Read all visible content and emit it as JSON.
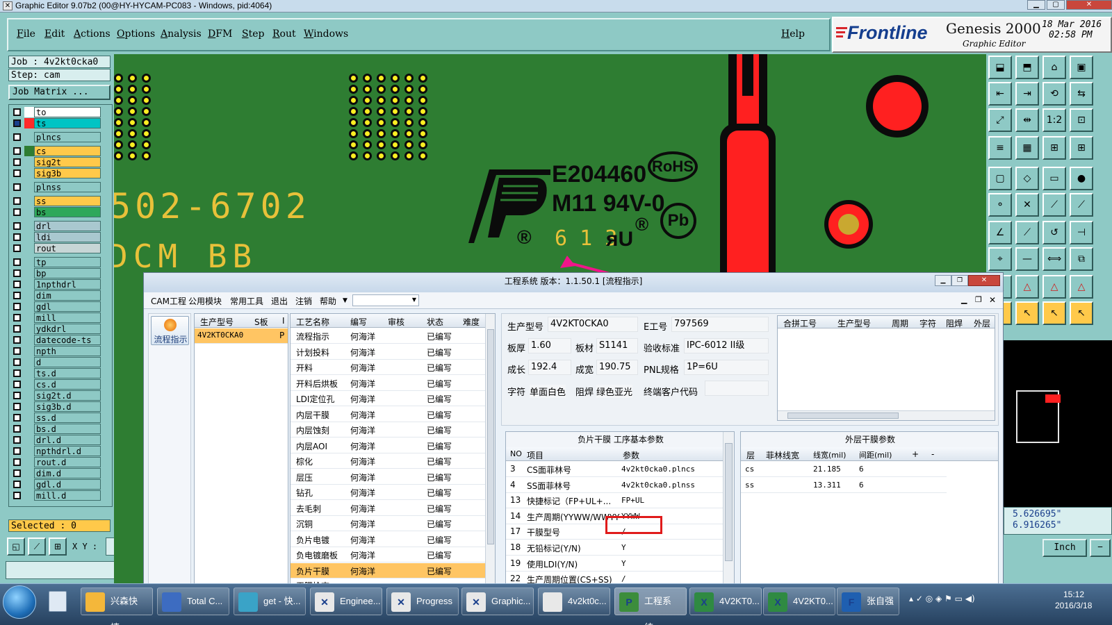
{
  "window": {
    "title": "Graphic Editor 9.07b2 (00@HY-HYCAM-PC083 - Windows, pid:4064)"
  },
  "menubar": {
    "items": [
      "File",
      "Edit",
      "Actions",
      "Options",
      "Analysis",
      "DFM",
      "Step",
      "Rout",
      "Windows"
    ],
    "help": "Help"
  },
  "logo": {
    "brand": "Frontline",
    "product": "Genesis 2000",
    "subtitle": "Graphic Editor",
    "date": "18 Mar 2016",
    "time": "02:58 PM"
  },
  "leftpanel": {
    "job": "Job : 4v2kt0cka0",
    "step": "Step: cam",
    "job_matrix": "Job Matrix ...",
    "selected": "Selected : 0",
    "xy_label": "X Y :"
  },
  "layers": [
    {
      "name": "to",
      "color": "#ffffff",
      "bg": "#ffffff"
    },
    {
      "name": "ts",
      "color": "#ff2a2a",
      "bg": "#00c4c4",
      "selected": true
    },
    {
      "name": "plncs",
      "color": "#8ec9c5",
      "bg": "#8ec9c5"
    },
    {
      "name": "cs",
      "color": "#2e7d32",
      "bg": "#ffc94a"
    },
    {
      "name": "sig2t",
      "color": "#8ec9c5",
      "bg": "#ffc94a"
    },
    {
      "name": "sig3b",
      "color": "#8ec9c5",
      "bg": "#ffc94a"
    },
    {
      "name": "plnss",
      "color": "#8ec9c5",
      "bg": "#8ec9c5"
    },
    {
      "name": "ss",
      "color": "#8ec9c5",
      "bg": "#ffc94a"
    },
    {
      "name": "bs",
      "color": "#8ec9c5",
      "bg": "#2ea85a"
    },
    {
      "name": "drl",
      "color": "#8ec9c5",
      "bg": "#a9c8cf"
    },
    {
      "name": "ldi",
      "color": "#8ec9c5",
      "bg": "#a9c8cf"
    },
    {
      "name": "rout",
      "color": "#8ec9c5",
      "bg": "#c7d6d6"
    },
    {
      "name": "tp",
      "color": "#8ec9c5",
      "bg": "#8ec9c5"
    },
    {
      "name": "bp",
      "color": "#8ec9c5",
      "bg": "#8ec9c5"
    },
    {
      "name": "1npthdrl",
      "color": "#8ec9c5",
      "bg": "#8ec9c5"
    },
    {
      "name": "dim",
      "color": "#8ec9c5",
      "bg": "#8ec9c5"
    },
    {
      "name": "gdl",
      "color": "#8ec9c5",
      "bg": "#8ec9c5"
    },
    {
      "name": "mill",
      "color": "#8ec9c5",
      "bg": "#8ec9c5"
    },
    {
      "name": "ydkdrl",
      "color": "#8ec9c5",
      "bg": "#8ec9c5"
    },
    {
      "name": "datecode-ts",
      "color": "#8ec9c5",
      "bg": "#8ec9c5"
    },
    {
      "name": "npth",
      "color": "#8ec9c5",
      "bg": "#8ec9c5"
    },
    {
      "name": "d",
      "color": "#8ec9c5",
      "bg": "#8ec9c5"
    },
    {
      "name": "ts.d",
      "color": "#8ec9c5",
      "bg": "#8ec9c5"
    },
    {
      "name": "cs.d",
      "color": "#8ec9c5",
      "bg": "#8ec9c5"
    },
    {
      "name": "sig2t.d",
      "color": "#8ec9c5",
      "bg": "#8ec9c5"
    },
    {
      "name": "sig3b.d",
      "color": "#8ec9c5",
      "bg": "#8ec9c5"
    },
    {
      "name": "ss.d",
      "color": "#8ec9c5",
      "bg": "#8ec9c5"
    },
    {
      "name": "bs.d",
      "color": "#8ec9c5",
      "bg": "#8ec9c5"
    },
    {
      "name": "drl.d",
      "color": "#8ec9c5",
      "bg": "#8ec9c5"
    },
    {
      "name": "npthdrl.d",
      "color": "#8ec9c5",
      "bg": "#8ec9c5"
    },
    {
      "name": "rout.d",
      "color": "#8ec9c5",
      "bg": "#8ec9c5"
    },
    {
      "name": "dim.d",
      "color": "#8ec9c5",
      "bg": "#8ec9c5"
    },
    {
      "name": "gdl.d",
      "color": "#8ec9c5",
      "bg": "#8ec9c5"
    },
    {
      "name": "mill.d",
      "color": "#8ec9c5",
      "bg": "#8ec9c5"
    }
  ],
  "canvas": {
    "pn_text": "502-6702",
    "bb_text": "DCM BB",
    "ul_code": "E204460",
    "rating": "M11 94V-0",
    "rohs": "RoHS",
    "pb": "Pb",
    "reg": "®",
    "date_digits": "6 1 3",
    "ur_mark": "ᴙU"
  },
  "coords": {
    "x": "5.626695\"",
    "y": "6.916265\"",
    "units": "Inch"
  },
  "cam": {
    "title": "工程系统  版本：1.1.50.1  [流程指示]",
    "menu": [
      "CAM工程",
      "公用模块",
      "常用工具",
      "退出",
      "注销",
      "帮助"
    ],
    "nav_button": "流程指示",
    "models_header": [
      "生产型号",
      "S板",
      "I"
    ],
    "model_row": [
      "4V2KT0CKA0",
      "P"
    ],
    "process_header": [
      "工艺名称",
      "编写",
      "审核",
      "状态",
      "难度"
    ],
    "process_rows": [
      [
        "流程指示",
        "何海洋",
        "",
        "已编写"
      ],
      [
        "计划投料",
        "何海洋",
        "",
        "已编写"
      ],
      [
        "开料",
        "何海洋",
        "",
        "已编写"
      ],
      [
        "开料后烘板",
        "何海洋",
        "",
        "已编写"
      ],
      [
        "LDI定位孔",
        "何海洋",
        "",
        "已编写"
      ],
      [
        "内层干膜",
        "何海洋",
        "",
        "已编写"
      ],
      [
        "内层蚀刻",
        "何海洋",
        "",
        "已编写"
      ],
      [
        "内层AOI",
        "何海洋",
        "",
        "已编写"
      ],
      [
        "棕化",
        "何海洋",
        "",
        "已编写"
      ],
      [
        "层压",
        "何海洋",
        "",
        "已编写"
      ],
      [
        "钻孔",
        "何海洋",
        "",
        "已编写"
      ],
      [
        "去毛刺",
        "何海洋",
        "",
        "已编写"
      ],
      [
        "沉铜",
        "何海洋",
        "",
        "已编写"
      ],
      [
        "负片电镀",
        "何海洋",
        "",
        "已编写"
      ],
      [
        "负电镀磨板",
        "何海洋",
        "",
        "已编写"
      ],
      [
        "负片干膜",
        "何海洋",
        "",
        "已编写"
      ]
    ],
    "process_partial": "干膜检查",
    "info": {
      "model_l": "生产型号",
      "model_v": "4V2KT0CKA0",
      "eno_l": "E工号",
      "eno_v": "797569",
      "thick_l": "板厚",
      "thick_v": "1.60",
      "mat_l": "板材",
      "mat_v": "S1141",
      "std_l": "验收标准",
      "std_v": "IPC-6012 II级",
      "len_l": "成长",
      "len_v": "192.4",
      "wid_l": "成宽",
      "wid_v": "190.75",
      "pnl_l": "PNL规格",
      "pnl_v": "1P=6U",
      "char_l": "字符",
      "char_v": "单面白色",
      "mask_l": "阻焊",
      "mask_v": "绿色亚光",
      "cust_l": "终端客户代码"
    },
    "merge_header": [
      "合拼工号",
      "生产型号",
      "周期",
      "字符",
      "阻焊",
      "外层"
    ],
    "params_title": "负片干膜  工序基本参数",
    "params_header": [
      "NO",
      "项目",
      "参数"
    ],
    "params_rows": [
      [
        "3",
        "CS面菲林号",
        "4v2kt0cka0.plncs"
      ],
      [
        "4",
        "SS面菲林号",
        "4v2kt0cka0.plnss"
      ],
      [
        "13",
        "快捷标记（FP+UL+...",
        "FP+UL"
      ],
      [
        "14",
        "生产周期(YYWW/WWYY)",
        "YYWW"
      ],
      [
        "17",
        "干膜型号",
        "/"
      ],
      [
        "18",
        "无铅标记(Y/N)",
        "Y"
      ],
      [
        "19",
        "使用LDI(Y/N)",
        "Y"
      ],
      [
        "22",
        "生产周期位置(CS+SS)",
        "/"
      ]
    ],
    "outer_title": "外层干膜参数",
    "outer_header": [
      "层",
      "菲林线宽",
      "线宽(mil)",
      "间距(mil)",
      "+",
      "-"
    ],
    "outer_rows": [
      [
        "cs",
        "",
        "21.185",
        "6"
      ],
      [
        "ss",
        "",
        "13.311",
        "6"
      ]
    ]
  },
  "taskbar": {
    "items": [
      "兴森快捷...",
      "Total C...",
      "get - 快...",
      "Enginee...",
      "Progress",
      "Graphic...",
      "4v2kt0c...",
      "工程系统...",
      "4V2KT0...",
      "4V2KT0...",
      "张自强"
    ],
    "time": "15:12",
    "date": "2016/3/18"
  }
}
